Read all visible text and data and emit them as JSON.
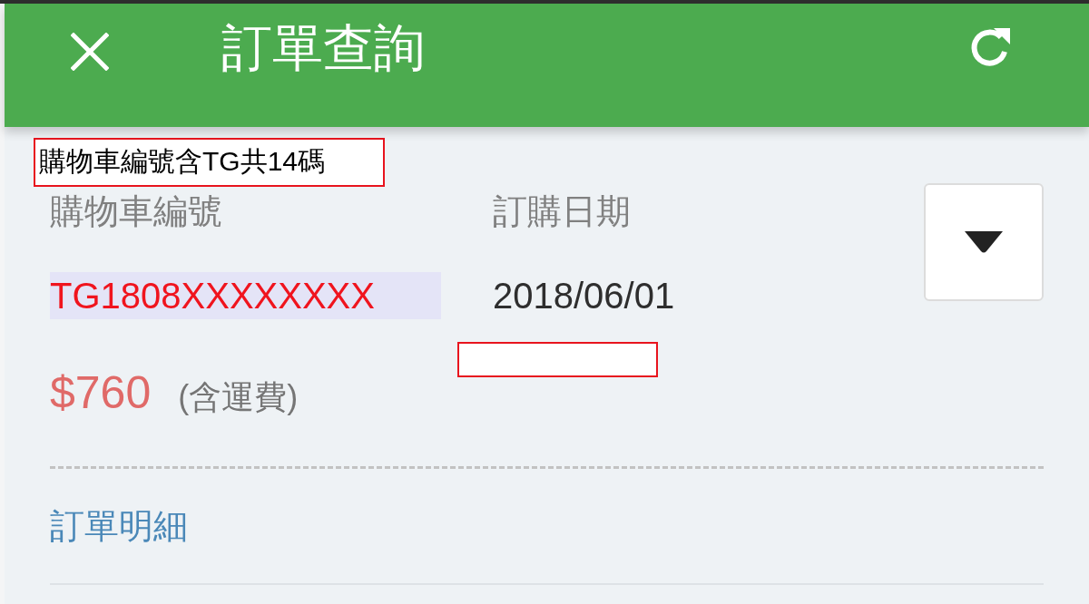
{
  "header": {
    "title": "訂單查詢"
  },
  "annotation": {
    "text": "購物車編號含TG共14碼"
  },
  "order": {
    "cart_label": "購物車編號",
    "date_label": "訂購日期",
    "cart_number": "TG1808XXXXXXXX",
    "cart_number_highlighted": true,
    "date": "2018/06/01",
    "price": "$760",
    "price_note": "(含運費)"
  },
  "details_link": "訂單明細"
}
